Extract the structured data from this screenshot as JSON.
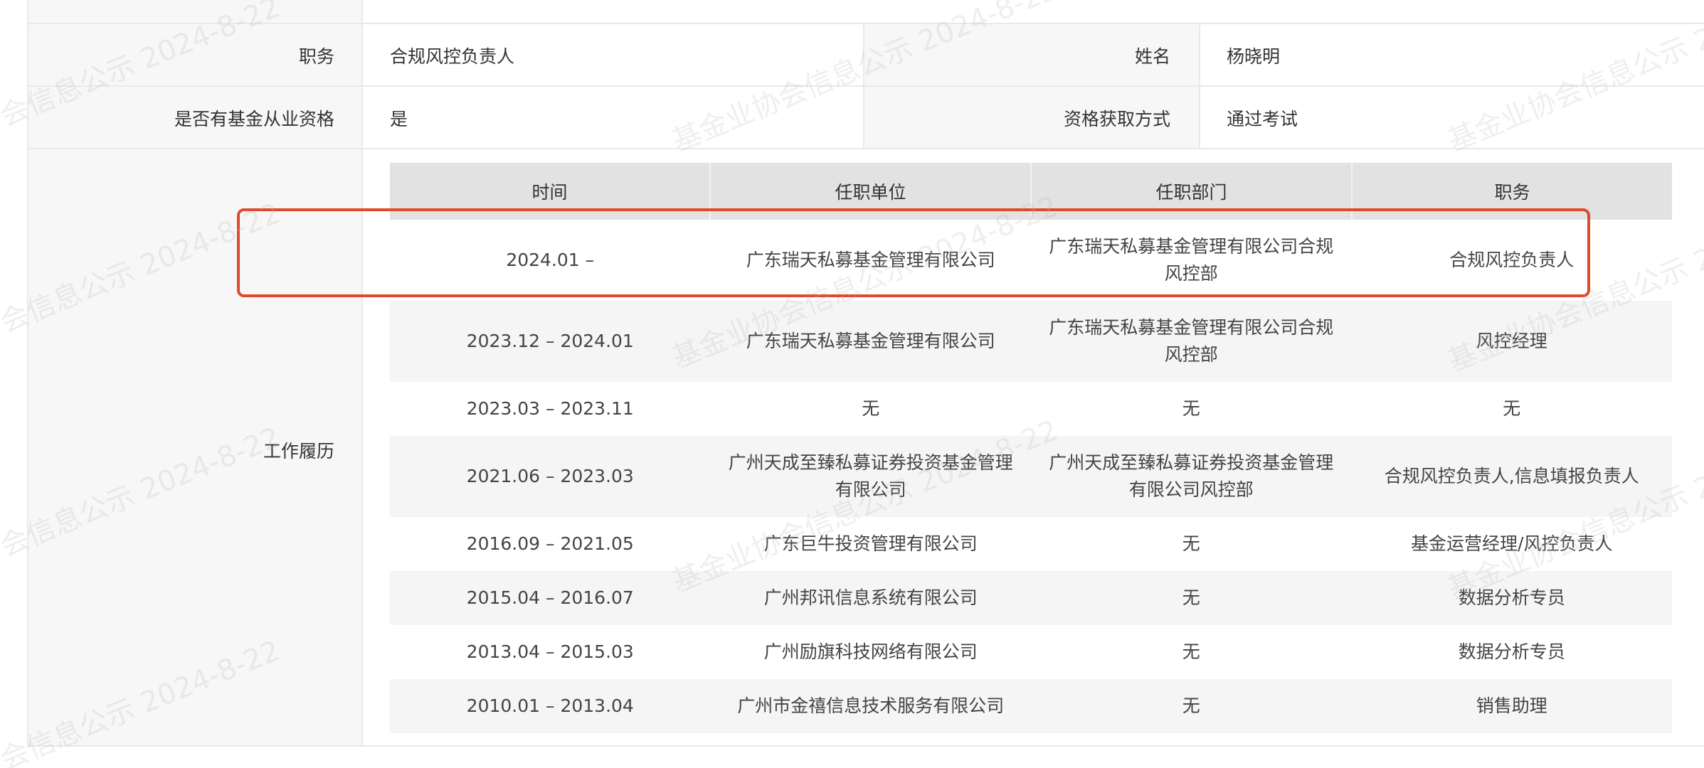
{
  "info": {
    "position_label": "职务",
    "position_value": "合规风控负责人",
    "name_label": "姓名",
    "name_value": "杨晓明",
    "qualification_label": "是否有基金从业资格",
    "qualification_value": "是",
    "qualification_method_label": "资格获取方式",
    "qualification_method_value": "通过考试",
    "work_history_label": "工作履历"
  },
  "work_history": {
    "headers": [
      "时间",
      "任职单位",
      "任职部门",
      "职务"
    ],
    "rows": [
      {
        "time": "2024.01 –",
        "company": "广东瑞天私募基金管理有限公司",
        "department": "广东瑞天私募基金管理有限公司合规风控部",
        "title": "合规风控负责人"
      },
      {
        "time": "2023.12 – 2024.01",
        "company": "广东瑞天私募基金管理有限公司",
        "department": "广东瑞天私募基金管理有限公司合规风控部",
        "title": "风控经理"
      },
      {
        "time": "2023.03 – 2023.11",
        "company": "无",
        "department": "无",
        "title": "无"
      },
      {
        "time": "2021.06 – 2023.03",
        "company": "广州天成至臻私募证券投资基金管理有限公司",
        "department": "广州天成至臻私募证券投资基金管理有限公司风控部",
        "title": "合规风控负责人,信息填报负责人"
      },
      {
        "time": "2016.09 – 2021.05",
        "company": "广东巨牛投资管理有限公司",
        "department": "无",
        "title": "基金运营经理/风控负责人"
      },
      {
        "time": "2015.04 – 2016.07",
        "company": "广州邦讯信息系统有限公司",
        "department": "无",
        "title": "数据分析专员"
      },
      {
        "time": "2013.04 – 2015.03",
        "company": "广州励旗科技网络有限公司",
        "department": "无",
        "title": "数据分析专员"
      },
      {
        "time": "2010.01 – 2013.04",
        "company": "广州市金禧信息技术服务有限公司",
        "department": "无",
        "title": "销售助理"
      }
    ]
  },
  "watermark": {
    "text_a": "会信息公示 2024-8-22",
    "text_b": "基金业协会信息公示 2024-8-22",
    "text_c": "基金业协会信息公示 20"
  },
  "colors": {
    "highlight": "#e04a2b",
    "header_bg": "#e2e2e2",
    "label_bg": "#f7f7f7"
  }
}
